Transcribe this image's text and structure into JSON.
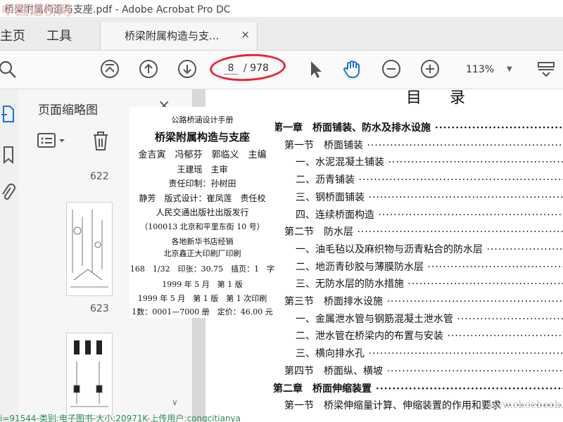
{
  "window": {
    "title": "桥梁附属构造与支座.pdf - Adobe Acrobat Pro DC",
    "watermark": "中国道桥网"
  },
  "tabs": {
    "home": "主页",
    "tools": "工具",
    "doc": "桥梁附属构造与支...",
    "close": "×"
  },
  "toolbar": {
    "page_current": "8",
    "page_total": "/ 978",
    "zoom": "113%",
    "icons": [
      "zoom-icon",
      "page-up-icon",
      "prev-page-icon",
      "next-page-icon",
      "select-cursor-icon",
      "hand-tool-icon",
      "zoom-out-icon",
      "zoom-in-icon",
      "zoom-dropdown-icon",
      "scrolling-mode-icon"
    ]
  },
  "panel": {
    "title": "页面缩略图",
    "close": "×",
    "thumbs": [
      {
        "label": "622"
      },
      {
        "label": "623"
      }
    ]
  },
  "colophon": [
    "公路桥涵设计手册",
    "桥梁附属构造与支座",
    "金吉寅　冯郁芬　郭临义　主编",
    "王建瑶　主审",
    "责任印制：孙树田",
    "静芳　版式设计：崔凤莲　责任校",
    "人民交通出版社出版发行",
    "（100013 北京和平里东街 10 号）",
    "各地新华书店经销",
    "北京鑫正大印刷厂印刷",
    "168　1/32　印张：30.75　插页：1　字",
    "1999 年 5 月　第 1 版",
    "1999 年 5 月　第 1 版　第 1 次印刷",
    "1数：0001—7000 册　定价：46.00 元"
  ],
  "toc": {
    "heading": "目录",
    "lines": [
      {
        "text": "第一章　桥面铺装、防水及排水设施",
        "indent": 0,
        "bold": true
      },
      {
        "text": "第一节　桥面铺装",
        "indent": 1,
        "bold": false
      },
      {
        "text": "一、水泥混凝土铺装",
        "indent": 2,
        "bold": false
      },
      {
        "text": "二、沥青铺装",
        "indent": 2,
        "bold": false
      },
      {
        "text": "三、钢桥面铺装",
        "indent": 2,
        "bold": false
      },
      {
        "text": "四、连续桥面构造",
        "indent": 2,
        "bold": false
      },
      {
        "text": "第二节　防水层",
        "indent": 1,
        "bold": false
      },
      {
        "text": "一、油毛毡以及麻织物与沥青粘合的防水层",
        "indent": 2,
        "bold": false
      },
      {
        "text": "二、地沥青砂胶与薄膜防水层",
        "indent": 2,
        "bold": false
      },
      {
        "text": "三、无防水层的防水措施",
        "indent": 2,
        "bold": false
      },
      {
        "text": "第三节　桥面排水设施",
        "indent": 1,
        "bold": false
      },
      {
        "text": "一、金属泄水管与钢筋混凝土泄水管",
        "indent": 2,
        "bold": false
      },
      {
        "text": "二、泄水管在桥梁内的布置与安装",
        "indent": 2,
        "bold": false
      },
      {
        "text": "三、横向排水孔",
        "indent": 2,
        "bold": false
      },
      {
        "text": "第四节　桥面纵、横坡",
        "indent": 1,
        "bold": false
      },
      {
        "text": "第二章　桥面伸缩装置",
        "indent": 0,
        "bold": true
      },
      {
        "text": "第一节　桥梁伸缩量计算、伸缩装置的作用和要求",
        "indent": 1,
        "bold": false
      }
    ]
  },
  "status": "i=91544-类别:电子图书-大小:20971K-上传用户:congcitianya",
  "site_watermark": "www.cbeebook.com",
  "colors": {
    "highlight": "#e22233",
    "frame": "#f2e600",
    "accent_blue": "#1a73d9"
  }
}
